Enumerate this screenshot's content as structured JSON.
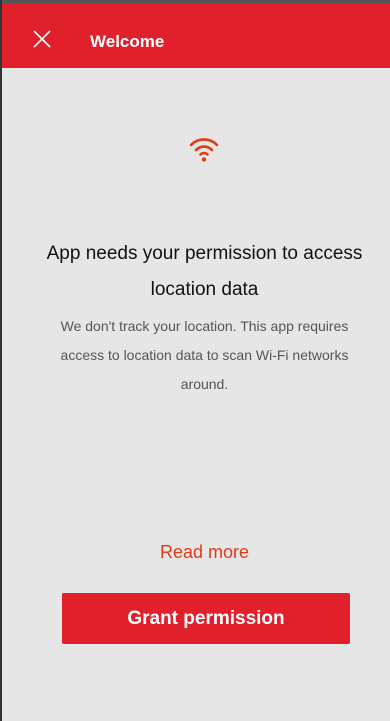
{
  "app_bar": {
    "title": "Welcome",
    "close_icon": "close-icon",
    "background_color": "#e0202b"
  },
  "main": {
    "icon": "wifi-icon",
    "icon_color": "#e23a12",
    "heading": "App needs your permission to access location data",
    "description": "We don't track your location. This app requires access to location data to scan Wi-Fi networks around.",
    "read_more_label": "Read more",
    "grant_button_label": "Grant permission"
  }
}
